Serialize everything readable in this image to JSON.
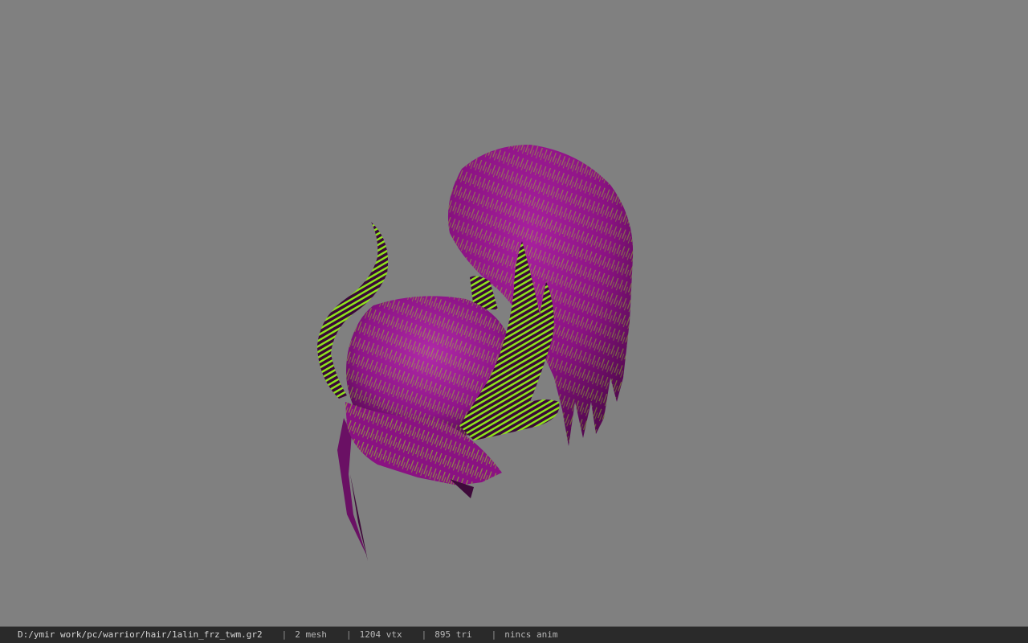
{
  "viewer": {
    "background_color": "#808080",
    "model_colors": {
      "primary": "#8e1488",
      "dark": "#4a0a46",
      "highlight": "#b02aa8",
      "stripe": "#8ee21e"
    },
    "model_icon": "hair-mesh-3d-model"
  },
  "status": {
    "file_path": "D:/ymir work/pc/warrior/hair/1alin_frz_twm.gr2",
    "separator": "|",
    "mesh": "2 mesh",
    "vertices": "1204 vtx",
    "triangles": "895 tri",
    "anim": "nincs anim"
  }
}
